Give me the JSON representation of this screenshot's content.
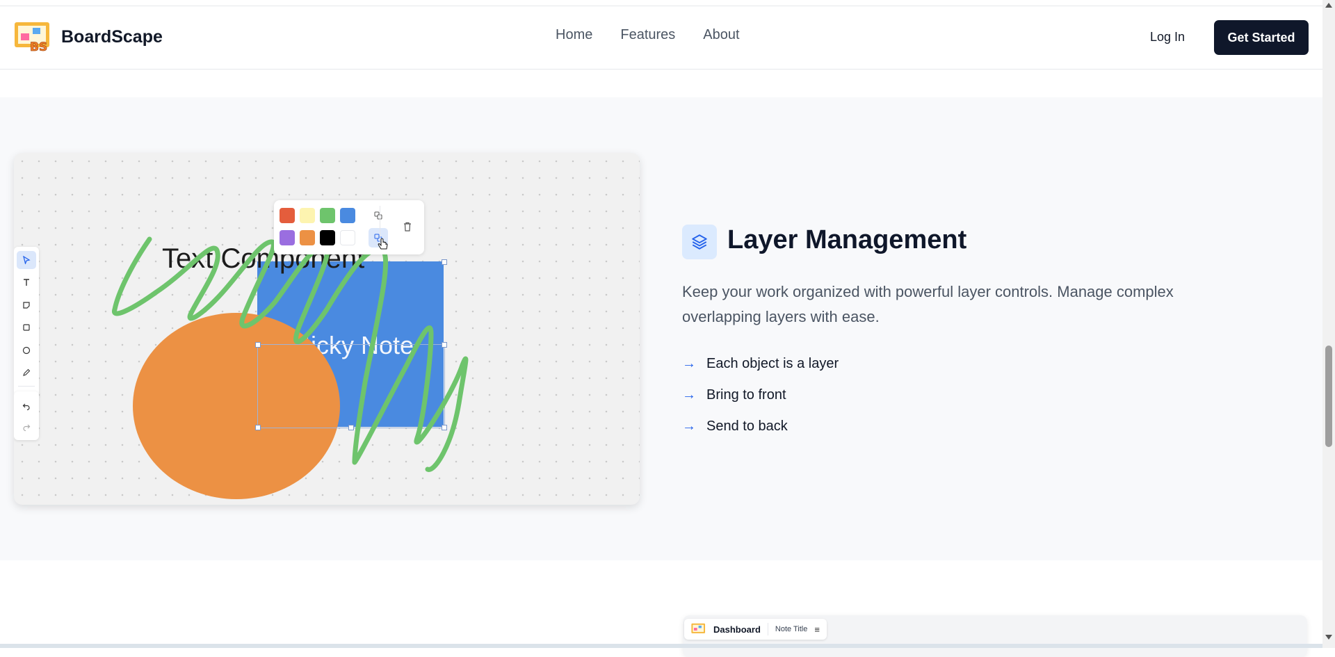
{
  "header": {
    "brand_name": "BoardScape",
    "logo_text": "BS",
    "nav": [
      "Home",
      "Features",
      "About"
    ],
    "login_label": "Log In",
    "cta_label": "Get Started"
  },
  "feature": {
    "title": "Layer Management",
    "icon": "layers-icon",
    "description": "Keep your work organized with powerful layer controls. Manage complex overlapping layers with ease.",
    "bullets": [
      "Each object is a layer",
      "Bring to front",
      "Send to back"
    ]
  },
  "demo_canvas": {
    "text_component": "Text Component",
    "sticky_note": "Sticky Note",
    "palette_colors": [
      "#e45d3c",
      "#fdf4b0",
      "#6ec46c",
      "#4a8ae0",
      "#9a6ee0",
      "#ec9144",
      "#000000",
      "#ffffff"
    ],
    "tools": [
      "select-icon",
      "text-icon",
      "sticky-note-icon",
      "rectangle-icon",
      "circle-icon",
      "pen-icon",
      "undo-icon",
      "redo-icon"
    ],
    "colors": {
      "sticky": "#4a8ae0",
      "ellipse": "#ec9144",
      "scribble": "#6ec46c"
    }
  },
  "next_preview": {
    "dashboard_label": "Dashboard",
    "note_title": "Note Title"
  },
  "theme": {
    "primary_dark": "#0f172a",
    "accent_blue": "#2563eb",
    "section_bg": "#f8f9fb"
  }
}
